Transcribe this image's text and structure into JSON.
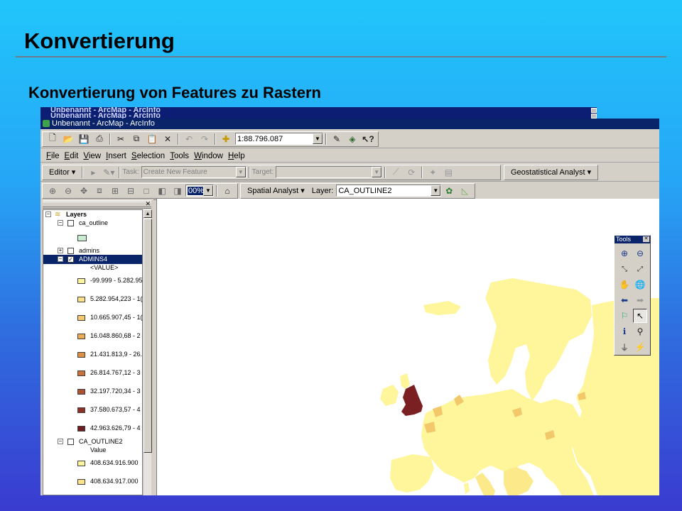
{
  "slide": {
    "title": "Konvertierung",
    "subtitle": "Konvertierung von Features zu Rastern"
  },
  "ghost_titles": [
    "Unbenannt - ArcMap - ArcInfo",
    "Unbenannt - ArcMap - ArcInfo"
  ],
  "window": {
    "title": "Unbenannt - ArcMap - ArcInfo"
  },
  "standard_toolbar": {
    "scale": "1:88.796.087"
  },
  "menu": [
    "File",
    "Edit",
    "View",
    "Insert",
    "Selection",
    "Tools",
    "Window",
    "Help"
  ],
  "editor_toolbar": {
    "editor_label": "Editor ▾",
    "task_label": "Task:",
    "task_value": "Create New Feature",
    "target_label": "Target:",
    "geostat_label": "Geostatistical Analyst ▾"
  },
  "spatial_toolbar": {
    "zoom_value": "00%",
    "spatial_label": "Spatial Analyst ▾",
    "layer_label": "Layer:",
    "layer_value": "CA_OUTLINE2"
  },
  "toc": {
    "root": "Layers",
    "layers": [
      {
        "name": "ca_outline",
        "checked": false
      },
      {
        "name": "admins",
        "checked": false
      },
      {
        "name": "ADMINS4",
        "checked": true,
        "selected": true,
        "field": "<VALUE>"
      },
      {
        "name": "CA_OUTLINE2",
        "checked": false,
        "field": "Value"
      }
    ],
    "ca_outline_swatch": "#c8ecd0",
    "admins4_classes": [
      {
        "label": "-99.999 - 5.282.95",
        "color": "#fff59a"
      },
      {
        "label": "5.282.954,223 - 1(",
        "color": "#fde28a"
      },
      {
        "label": "10.665.907,45 - 1(",
        "color": "#f7c86e"
      },
      {
        "label": "16.048.860,68 - 2",
        "color": "#eeab56"
      },
      {
        "label": "21.431.813,9 - 26.",
        "color": "#dd9044"
      },
      {
        "label": "26.814.767,12 - 3",
        "color": "#c97338"
      },
      {
        "label": "32.197.720,34 - 3",
        "color": "#ad5230"
      },
      {
        "label": "37.580.673,57 - 4",
        "color": "#8e3226"
      },
      {
        "label": "42.963.626,79 - 4",
        "color": "#6e1c1e"
      }
    ],
    "ca_outline2_classes": [
      {
        "label": "408.634.916.900",
        "color": "#fff59a"
      },
      {
        "label": "408.634.917.000",
        "color": "#fde28a"
      }
    ]
  },
  "tools_window": {
    "title": "Tools",
    "buttons": [
      "zoom-in-icon",
      "zoom-out-icon",
      "fixed-zoom-in-icon",
      "fixed-zoom-out-icon",
      "pan-icon",
      "full-extent-icon",
      "back-extent-icon",
      "forward-extent-icon",
      "select-features-icon",
      "select-elements-icon",
      "identify-icon",
      "find-icon",
      "measure-icon",
      "hyperlink-icon"
    ]
  },
  "colors": {
    "map_yellow": "#fff59a",
    "map_yellow2": "#fbe98a",
    "map_orange": "#f3c86a",
    "map_dark": "#7a1f22",
    "titlebar": "#0a246a"
  }
}
